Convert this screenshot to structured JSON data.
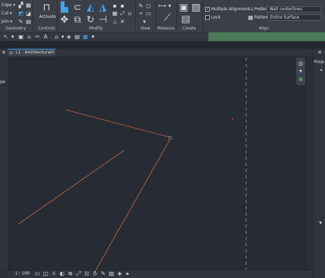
{
  "ribbon": {
    "geometry": {
      "label": "Geometry",
      "cope_label": "Cope",
      "cut_label": "Cut",
      "join_label": "Join"
    },
    "controls": {
      "label": "Controls",
      "activate_label": "Activate"
    },
    "modify": {
      "label": "Modify"
    },
    "view": {
      "label": "View"
    },
    "measure": {
      "label": "Measure"
    },
    "create": {
      "label": "Create"
    },
    "align": {
      "label": "Align",
      "multiple_alignment_label": "Multiple Alignment",
      "multiple_alignment_checked": true,
      "lock_label": "Lock",
      "lock_checked": false,
      "prefer_label": "Prefer:",
      "prefer_value": "Wall centerlines",
      "pattern_label": "Pattern:",
      "pattern_value": "Entire Surface"
    }
  },
  "left_panel": {
    "fragment_label": "pe"
  },
  "view_tab": {
    "title": "L1 - Architectural",
    "close_glyph": "×"
  },
  "right_panel": {
    "title_fragment": "Proje"
  },
  "status_bar": {
    "scale": "1 : 100"
  },
  "colors": {
    "canvas": "#272b33",
    "sketch_line": "#c0674a",
    "accent": "#4aa3e8",
    "cursor_point": "#e03b3b"
  }
}
